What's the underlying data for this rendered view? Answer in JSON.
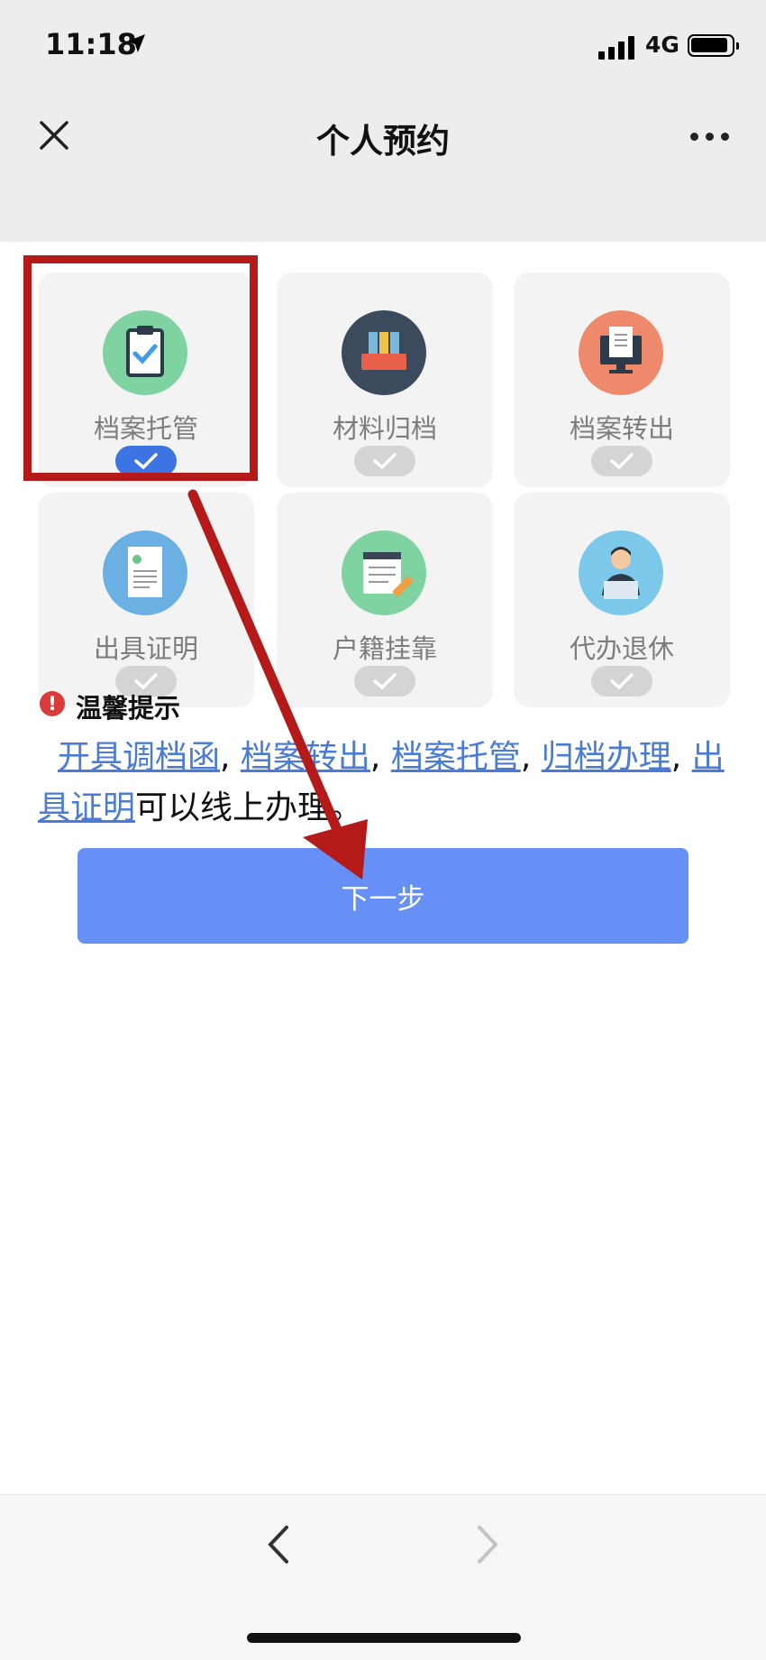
{
  "status_bar": {
    "time": "11:18",
    "network": "4G"
  },
  "navbar": {
    "title": "个人预约"
  },
  "services": [
    {
      "label": "档案托管",
      "icon": "clipboard-icon",
      "icon_color": "#7fd3a0",
      "selected": true
    },
    {
      "label": "材料归档",
      "icon": "binders-icon",
      "icon_color": "#3b4a5c",
      "selected": false
    },
    {
      "label": "档案转出",
      "icon": "monitor-icon",
      "icon_color": "#ee8a6b",
      "selected": false
    },
    {
      "label": "出具证明",
      "icon": "certificate-icon",
      "icon_color": "#6ab0e3",
      "selected": false
    },
    {
      "label": "户籍挂靠",
      "icon": "notepad-pencil-icon",
      "icon_color": "#7fd3a0",
      "selected": false
    },
    {
      "label": "代办退休",
      "icon": "person-laptop-icon",
      "icon_color": "#7cc8ea",
      "selected": false
    }
  ],
  "tips": {
    "title": "温馨提示",
    "links": [
      "开具调档函",
      "档案转出",
      "档案托管",
      "归档办理",
      "出具证明"
    ],
    "separator": ", ",
    "suffix": "可以线上办理。"
  },
  "next_button": {
    "label": "下一步"
  },
  "colors": {
    "accent": "#6690f5",
    "selected_check": "#3d74e4",
    "link": "#4a7bd5",
    "annotation": "#b41a1a"
  }
}
